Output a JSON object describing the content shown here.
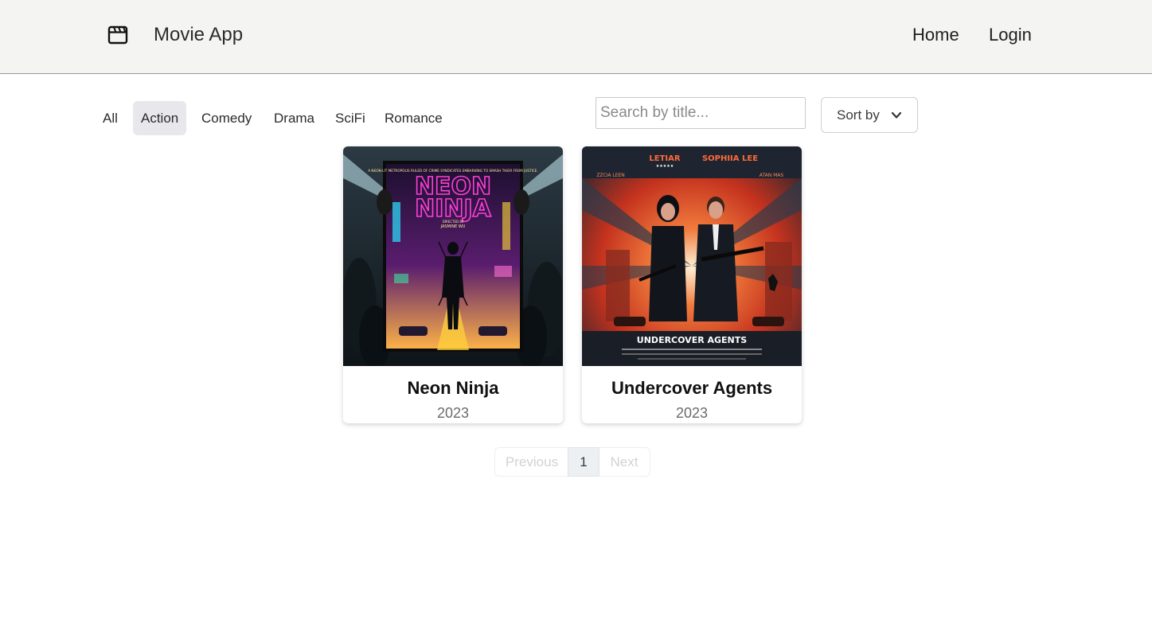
{
  "header": {
    "brand_icon": "clapperboard-icon",
    "brand_name": "Movie App",
    "nav": {
      "home": "Home",
      "login": "Login"
    }
  },
  "filters": {
    "genres": [
      "All",
      "Action",
      "Comedy",
      "Drama",
      "SciFi",
      "Romance"
    ],
    "active_genre": "Action",
    "search_placeholder": "Search by title...",
    "sort_label": "Sort by",
    "sort_icon": "chevron-down-icon"
  },
  "movies": [
    {
      "title": "Neon Ninja",
      "year": "2023",
      "poster": {
        "title_line1": "NEON",
        "title_line2": "NINJA",
        "tagline": "A NEON-LIT METROPOLIS RULED OF CRIME SYNDICATES EMBARKING TO SMASH THEIR FROM JUSTICE.",
        "credit_label": "DIRECTED BY",
        "credit_name": "JASMINE WU",
        "colors": {
          "neon": "#ff3fd8",
          "bg": "#2a1840",
          "glow": "#ffd23a"
        }
      }
    },
    {
      "title": "Undercover Agents",
      "year": "2023",
      "poster": {
        "title": "UNDERCOVER AGENTS",
        "top_names": [
          "LETIAR",
          "SOPHIIA LEE"
        ],
        "side_names": [
          "ZZCIA LEEN",
          "ATAN MAS"
        ],
        "stars": "★★★★★",
        "colors": {
          "accent": "#e8462a",
          "bg": "#1e2430"
        }
      }
    }
  ],
  "pagination": {
    "prev": "Previous",
    "current": "1",
    "next": "Next"
  }
}
